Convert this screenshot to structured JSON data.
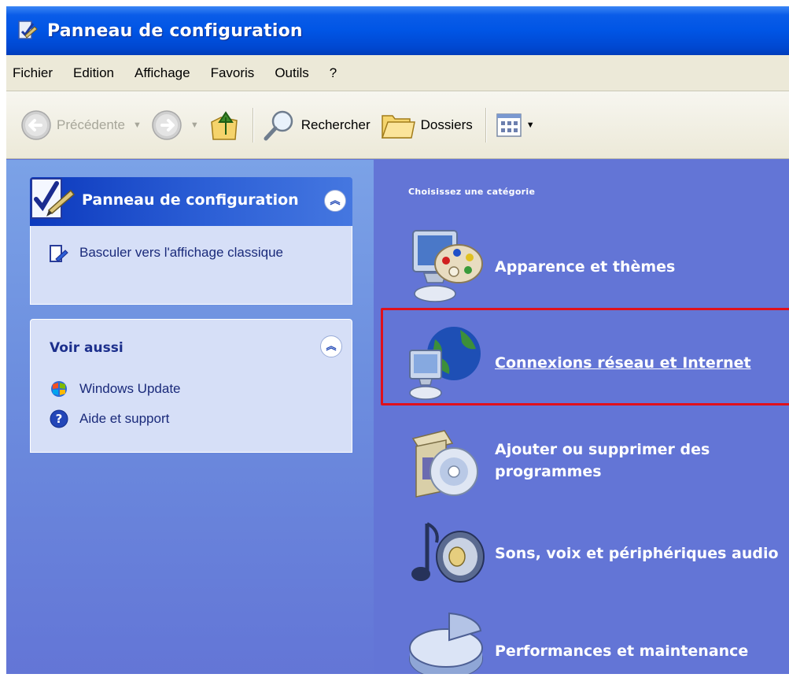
{
  "window": {
    "title": "Panneau de configuration"
  },
  "menu": {
    "items": [
      "Fichier",
      "Edition",
      "Affichage",
      "Favoris",
      "Outils",
      "?"
    ]
  },
  "toolbar": {
    "back_label": "Précédente",
    "search_label": "Rechercher",
    "folders_label": "Dossiers"
  },
  "sidebar": {
    "panel_title": "Panneau de configuration",
    "switch_view": "Basculer vers l'affichage classique",
    "see_also_title": "Voir aussi",
    "see_also_links": [
      "Windows Update",
      "Aide et support"
    ]
  },
  "main": {
    "pick_category": "Choisissez une catégorie",
    "categories": [
      "Apparence et thèmes",
      "Connexions réseau et Internet",
      "Ajouter ou supprimer des programmes",
      "Sons, voix et périphériques audio",
      "Performances et maintenance"
    ],
    "highlighted_category": "Connexions réseau et Internet",
    "highlight_color": "#e0101b"
  },
  "colors": {
    "titlebar": "#0055e5",
    "menubar": "#ece9d8",
    "main_bg": "#6375d6",
    "sidebar_box": "#d6dff7"
  }
}
